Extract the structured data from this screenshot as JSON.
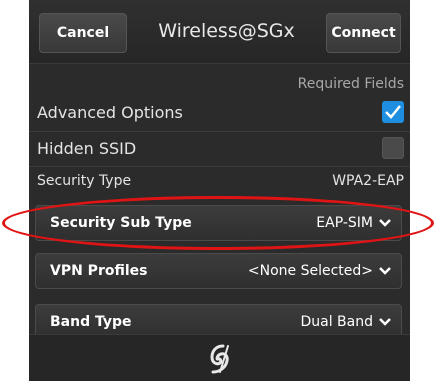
{
  "header": {
    "cancel_label": "Cancel",
    "title": "Wireless@SGx",
    "connect_label": "Connect"
  },
  "form": {
    "required_fields": "Required Fields",
    "advanced_options": {
      "label": "Advanced Options",
      "checked": true
    },
    "hidden_ssid": {
      "label": "Hidden SSID",
      "checked": false
    },
    "security_type": {
      "label": "Security Type",
      "value": "WPA2-EAP"
    },
    "dropdowns": [
      {
        "label": "Security Sub Type",
        "value": "EAP-SIM"
      },
      {
        "label": "VPN Profiles",
        "value": "<None Selected>"
      },
      {
        "label": "Band Type",
        "value": "Dual Band"
      }
    ]
  },
  "footer": {
    "icon": "blackberry-logo-icon"
  },
  "colors": {
    "accent": "#1e8fe0",
    "highlight": "#e01414",
    "background": "#2b2b2b"
  }
}
